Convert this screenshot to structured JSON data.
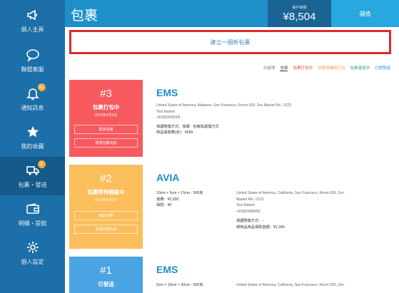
{
  "sidebar": {
    "items": [
      {
        "label": "個人主頁",
        "icon": "megaphone-icon",
        "badge": ""
      },
      {
        "label": "聯盟客服",
        "icon": "chat-bubble-icon",
        "badge": ""
      },
      {
        "label": "通知訊息",
        "icon": "bell-icon",
        "badge": "11"
      },
      {
        "label": "我的收藏",
        "icon": "star-icon",
        "badge": ""
      },
      {
        "label": "包裹・發送",
        "icon": "truck-icon",
        "badge": "2"
      },
      {
        "label": "明細・提款",
        "icon": "wallet-icon",
        "badge": ""
      },
      {
        "label": "個人設定",
        "icon": "gear-icon",
        "badge": ""
      }
    ],
    "active_index": 4
  },
  "header": {
    "title": "包裹",
    "balance_label": "帳戶餘額",
    "balance_value": "¥8,504",
    "topup_label": "儲值"
  },
  "new_parcel_label": "建立一個新包裹",
  "filters": [
    {
      "label": "待處理",
      "style": "gray"
    },
    {
      "label": "全部",
      "style": "active"
    },
    {
      "label": "包裹打包中",
      "style": "red"
    },
    {
      "label": "包裹待確認打包",
      "style": "orange"
    },
    {
      "label": "包裹運送中",
      "style": "green"
    },
    {
      "label": "已經發送",
      "style": "blue"
    }
  ],
  "cards": [
    {
      "number": "#3",
      "status": "包裹打包中",
      "date": "2018年4月9日",
      "color": "#f65a5f",
      "buttons": [
        "取消包裹",
        "修改包裹內容"
      ],
      "carrier": "EMS",
      "address": [
        "United States of America, Alabama, San Francisco, Room 505, Zen Market Rd., 0123",
        "Test Market",
        "+81600000000"
      ],
      "info": [
        "保護賠償方式：保價 · 包裝與處理方式",
        "商品保險費(含)：¥599"
      ]
    },
    {
      "number": "#2",
      "status": "包裹等待確認中",
      "date": "2018年4月6日",
      "color": "#fbbe5c",
      "buttons": [
        "確認包裹",
        "取消包裹內容"
      ],
      "carrier": "AVIA",
      "dims": "10cm × 5cm × 15cm - 500克",
      "shipping": "運費：¥2,500",
      "other": "保險：¥0",
      "address": [
        "United States of America, California, San Francisco, Room 505, Zen",
        "Market Rd., 0123",
        "Test Market",
        "+81600000000"
      ],
      "info": [
        "保護賠償方式：-",
        "總商品商品保險金額：¥2,340"
      ]
    },
    {
      "number": "#1",
      "status": "已發送",
      "date": "",
      "color": "#4aa3e3",
      "buttons": [],
      "carrier": "EMS",
      "dims": "5cm × 10cm × 30cm - 500克",
      "address": [
        "United States of America, California, San Francisco, Room 505, Zen"
      ],
      "info": []
    }
  ]
}
